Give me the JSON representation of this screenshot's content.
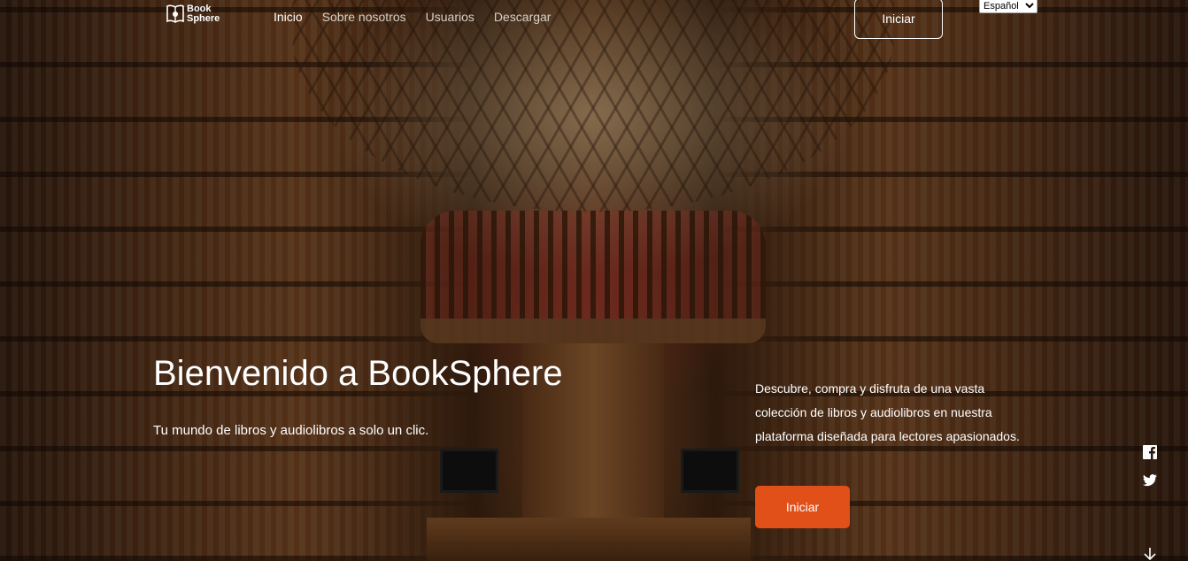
{
  "brand": {
    "line1": "Book",
    "line2": "Sphere"
  },
  "nav": {
    "items": [
      {
        "label": "Inicio",
        "active": true
      },
      {
        "label": "Sobre nosotros",
        "active": false
      },
      {
        "label": "Usuarios",
        "active": false
      },
      {
        "label": "Descargar",
        "active": false
      }
    ],
    "login_label": "Iniciar",
    "language": {
      "selected": "Español"
    }
  },
  "hero": {
    "title": "Bienvenido a BookSphere",
    "subtitle": "Tu mundo de libros y audiolibros a solo un clic.",
    "description": "Descubre, compra y disfruta de una vasta colección de libros y audiolibros en nuestra plataforma diseñada para lectores apasionados.",
    "cta_label": "Iniciar"
  },
  "social": {
    "icons": [
      "facebook-icon",
      "twitter-icon"
    ]
  },
  "colors": {
    "accent": "#e2501a",
    "text": "#ffffff"
  }
}
